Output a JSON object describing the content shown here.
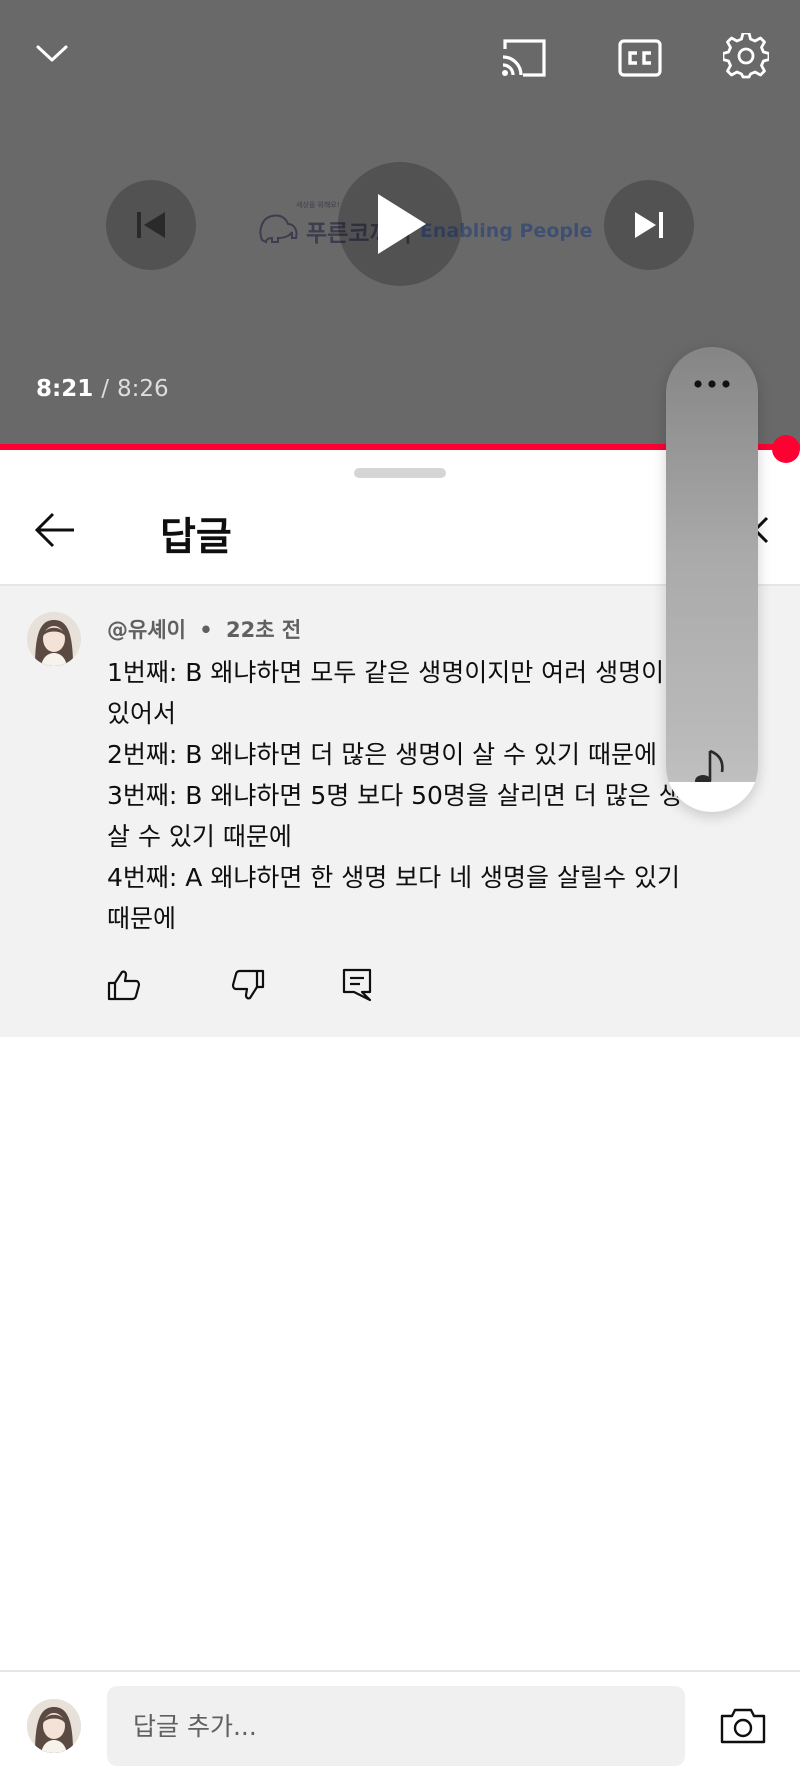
{
  "player": {
    "logo": {
      "tag": "세상을 위해요!",
      "brand_ko": "푸른코끼리",
      "brand_en": "Enabling People"
    },
    "current_time": "8:21",
    "separator": "/",
    "duration": "8:26",
    "progress": 0.99,
    "icons": {
      "collapse": "chevron-down-icon",
      "cast": "cast-icon",
      "captions": "cc-icon",
      "settings": "gear-icon",
      "previous": "skip-previous-icon",
      "play": "play-icon",
      "next": "skip-next-icon"
    }
  },
  "replies_sheet": {
    "title": "답글",
    "comment": {
      "author": "@유셰이",
      "dot": "•",
      "time": "22초 전",
      "lines": [
        "1번째: B 왜냐하면 모두 같은 생명이지만 여러 생명이",
        "있어서",
        "2번째: B 왜냐하면 더 많은 생명이 살 수 있기 때문에",
        "3번째: B 왜냐하면 5명 보다 50명을 살리면 더 많은 생명이",
        "살 수 있기 때문에",
        "4번째: A 왜냐하면 한 생명 보다 네 생명을 살릴수 있기",
        "때문에"
      ]
    },
    "reply_input": {
      "placeholder": "답글 추가..."
    }
  },
  "colors": {
    "accent": "#ff0033",
    "player_bg": "#696969",
    "comment_bg": "#f2f2f2",
    "input_bg": "#f0f0f0"
  }
}
